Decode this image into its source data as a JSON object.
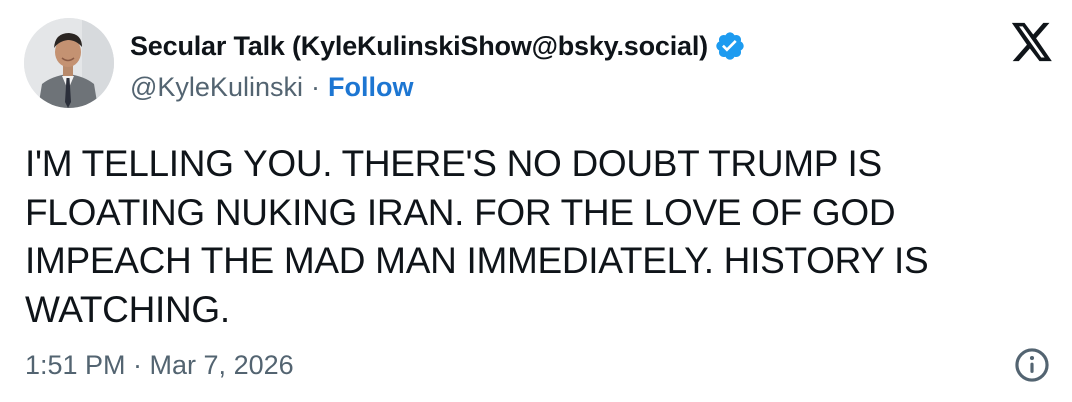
{
  "author": {
    "display_name": "Secular Talk (KyleKulinskiShow@bsky.social)",
    "handle": "@KyleKulinski",
    "separator": "·",
    "follow_label": "Follow",
    "verified_icon": "verified-badge-icon",
    "avatar_icon": "profile-photo"
  },
  "brand": {
    "logo_icon": "x-logo-icon"
  },
  "tweet": {
    "text": "I'M TELLING YOU. THERE'S NO DOUBT TRUMP IS FLOATING NUKING IRAN. FOR THE LOVE OF GOD IMPEACH THE MAD MAN IMMEDIATELY. HISTORY IS WATCHING.",
    "timestamp": "1:51 PM · Mar 7, 2026",
    "info_icon": "info-icon"
  },
  "colors": {
    "text": "#0f1419",
    "secondary": "#536471",
    "link": "#1d76d2",
    "verified": "#1d9bf0"
  }
}
